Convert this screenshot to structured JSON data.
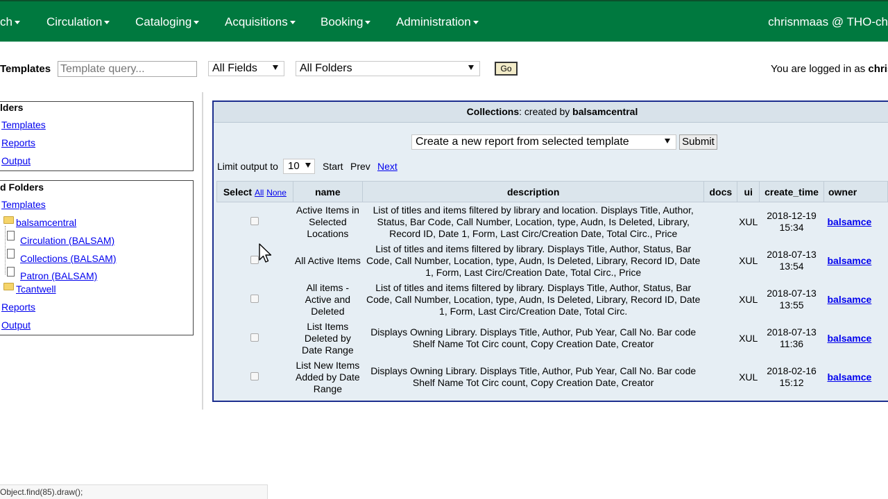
{
  "nav": {
    "partial_search": "ch",
    "items": [
      "Circulation",
      "Cataloging",
      "Acquisitions",
      "Booking",
      "Administration"
    ],
    "user": "chrisnmaas @ THO-ch"
  },
  "search": {
    "label": "Templates",
    "placeholder": "Template query...",
    "field": "All Fields",
    "folder": "All Folders",
    "go": "Go"
  },
  "login": {
    "prefix": "You are logged in as",
    "user": "chris"
  },
  "my_folders": {
    "title": "lders",
    "links": [
      "Templates",
      "Reports",
      "Output"
    ]
  },
  "shared_folders": {
    "title": "d Folders",
    "templates": "Templates",
    "owner": "balsamcentral",
    "children": [
      "Circulation (BALSAM)",
      "Collections (BALSAM)",
      "Patron (BALSAM)"
    ],
    "owner2": "Tcantwell",
    "reports": "Reports",
    "output": "Output"
  },
  "panel": {
    "heading_category": "Collections",
    "heading_mid": ": created by ",
    "heading_owner": "balsamcentral",
    "action": "Create a new report from selected template",
    "submit": "Submit",
    "limit_label": "Limit output to",
    "limit_value": "10",
    "start": "Start",
    "prev": "Prev",
    "next": "Next"
  },
  "table": {
    "headers": {
      "select": "Select",
      "all": "All",
      "none": "None",
      "name": "name",
      "description": "description",
      "docs": "docs",
      "ui": "ui",
      "create_time": "create_time",
      "owner": "owner"
    },
    "rows": [
      {
        "name": "Active Items in Selected Locations",
        "description": "List of titles and items filtered by library and location. Displays Title, Author, Status, Bar Code, Call Number, Location, type, Audn, Is Deleted, Library, Record ID, Date 1, Form, Last Circ/Creation Date, Total Circ., Price",
        "docs": "",
        "ui": "XUL",
        "create_time": "2018-12-19 15:34",
        "owner": "balsamce"
      },
      {
        "name": "All Active Items",
        "description": "List of titles and items filtered by library. Displays Title, Author, Status, Bar Code, Call Number, Location, type, Audn, Is Deleted, Library, Record ID, Date 1, Form, Last Circ/Creation Date, Total Circ., Price",
        "docs": "",
        "ui": "XUL",
        "create_time": "2018-07-13 13:54",
        "owner": "balsamce"
      },
      {
        "name": "All items - Active and Deleted",
        "description": "List of titles and items filtered by library. Displays Title, Author, Status, Bar Code, Call Number, Location, type, Audn, Is Deleted, Library, Record ID, Date 1, Form, Last Circ/Creation Date, Total Circ.",
        "docs": "",
        "ui": "XUL",
        "create_time": "2018-07-13 13:55",
        "owner": "balsamce"
      },
      {
        "name": "List Items Deleted by Date Range",
        "description": "Displays Owning Library. Displays Title, Author, Pub Year, Call No. Bar code Shelf Name Tot Circ count, Copy Creation Date, Creator",
        "docs": "",
        "ui": "XUL",
        "create_time": "2018-07-13 11:36",
        "owner": "balsamce"
      },
      {
        "name": "List New Items Added by Date Range",
        "description": "Displays Owning Library. Displays Title, Author, Pub Year, Call No. Bar code Shelf Name Tot Circ count, Copy Creation Date, Creator",
        "docs": "",
        "ui": "XUL",
        "create_time": "2018-02-16 15:12",
        "owner": "balsamce"
      }
    ]
  },
  "statusbar": "Object.find(85).draw();",
  "colors": {
    "nav_bg": "#00793f",
    "panel_border": "#1c2e8e",
    "panel_bg": "#e6eef4",
    "link": "#0000ee"
  }
}
